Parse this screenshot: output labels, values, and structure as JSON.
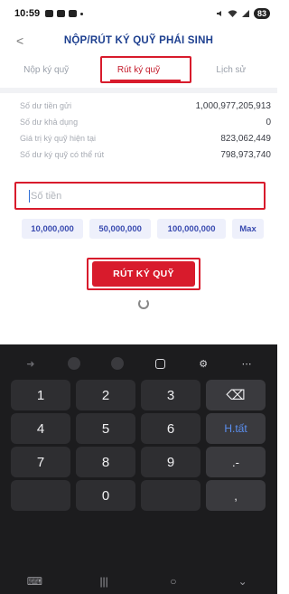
{
  "status_bar": {
    "time": "10:59",
    "battery": "83"
  },
  "header": {
    "back_glyph": "<",
    "title": "NỘP/RÚT KÝ QUỸ PHÁI SINH"
  },
  "tabs": [
    {
      "label": "Nộp ký quỹ",
      "active": false
    },
    {
      "label": "Rút ký quỹ",
      "active": true
    },
    {
      "label": "Lịch sử",
      "active": false
    }
  ],
  "info_rows": [
    {
      "label": "Số dư tiền gửi",
      "value": "1,000,977,205,913"
    },
    {
      "label": "Số dư khả dụng",
      "value": "0"
    },
    {
      "label": "Giá trị ký quỹ hiện tại",
      "value": "823,062,449"
    },
    {
      "label": "Số dư ký quỹ có thể rút",
      "value": "798,973,740"
    }
  ],
  "amount_input": {
    "placeholder": "Số tiền",
    "value": ""
  },
  "preset_chips": [
    "10,000,000",
    "50,000,000",
    "100,000,000",
    "Max"
  ],
  "submit_label": "RÚT KÝ QUỸ",
  "keyboard": {
    "keys": [
      "1",
      "2",
      "3",
      "⌫",
      "4",
      "5",
      "6",
      "H.tất",
      "7",
      "8",
      "9",
      ".-",
      "",
      "0",
      "",
      ","
    ]
  },
  "nav_bar": {
    "icons": [
      "keyboard-hide-icon",
      "recents-icon",
      "home-icon",
      "back-icon"
    ]
  },
  "colors": {
    "accent": "#d81b2c",
    "title_blue": "#1d3f8f",
    "chip_text": "#3a4bb0",
    "keyboard_bg": "#1c1c1e"
  }
}
